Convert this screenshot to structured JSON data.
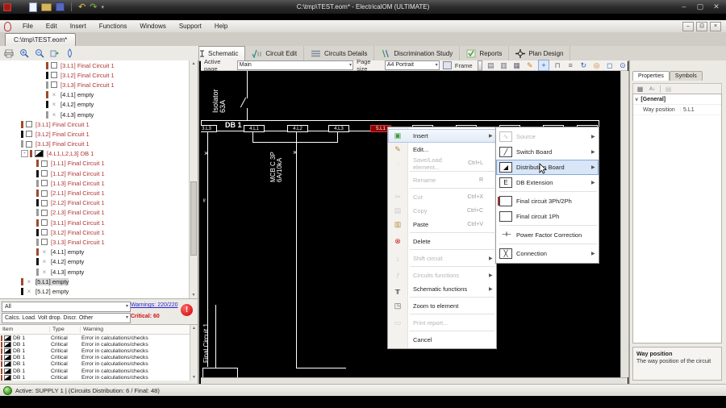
{
  "window": {
    "title": "C:\\tmp\\TEST.eom* - ElectricalOM (ULTIMATE)"
  },
  "menubar": {
    "items": [
      {
        "label": "File"
      },
      {
        "label": "Edit"
      },
      {
        "label": "Insert"
      },
      {
        "label": "Functions"
      },
      {
        "label": "Windows"
      },
      {
        "label": "Support"
      },
      {
        "label": "Help"
      }
    ]
  },
  "doc_tab": {
    "label": "C:\\tmp\\TEST.eom*"
  },
  "ribbon": {
    "tabs": [
      {
        "label": "Schematic"
      },
      {
        "label": "Circuit Edit"
      },
      {
        "label": "Circuits Details"
      },
      {
        "label": "Discrimination Study"
      },
      {
        "label": "Reports"
      },
      {
        "label": "Plan Design"
      }
    ]
  },
  "canvas_toolbar": {
    "active_page_label": "Active page",
    "active_page_value": "Main",
    "page_size_label": "Page size",
    "page_size_value": "A4 Portrait",
    "frame_label": "Frame",
    "icons": [
      "print",
      "export",
      "print-preview",
      "edit",
      "move",
      "ruler",
      "align",
      "refresh",
      "link",
      "select-region",
      "zoom"
    ]
  },
  "left_toolbar": {
    "icons": [
      "print",
      "zoom-in",
      "zoom-out",
      "refresh-tree",
      "validate"
    ]
  },
  "tree": {
    "items": [
      {
        "cls": "ind2 ph-l1 kind-circuit",
        "label": "[3.L1] Final Circuit 1"
      },
      {
        "cls": "ind2 ph-l2 kind-circuit",
        "label": "[3.L2] Final Circuit 1"
      },
      {
        "cls": "ind2 ph-l3 kind-circuit",
        "label": "[3.L3] Final Circuit 1"
      },
      {
        "cls": "ind2 ph-l1 kind-empty",
        "label": "[4.L1] empty"
      },
      {
        "cls": "ind2 ph-l2 kind-empty",
        "label": "[4.L2] empty"
      },
      {
        "cls": "ind2 ph-l3 kind-empty",
        "label": "[4.L3] empty"
      },
      {
        "cls": "ind0 ph-l1 kind-circuit",
        "label": "[3.L1] Final Circuit 1"
      },
      {
        "cls": "ind0 ph-l2 kind-circuit",
        "label": "[3.L2] Final Circuit 1"
      },
      {
        "cls": "ind0 ph-l3 kind-circuit",
        "label": "[3.L3] Final Circuit 1"
      },
      {
        "cls": "ind0 ph-l1 kind-db",
        "label": "[4.L1,L2,L3] DB 1",
        "expander": "-"
      },
      {
        "cls": "ind1 ph-l1 kind-circuit",
        "label": "[1.L1] Final Circuit 1"
      },
      {
        "cls": "ind1 ph-l2 kind-circuit",
        "label": "[1.L2] Final Circuit 1"
      },
      {
        "cls": "ind1 ph-l3 kind-circuit",
        "label": "[1.L3] Final Circuit 1"
      },
      {
        "cls": "ind1 ph-l1 kind-circuit",
        "label": "[2.L1] Final Circuit 1"
      },
      {
        "cls": "ind1 ph-l2 kind-circuit",
        "label": "[2.L2] Final Circuit 1"
      },
      {
        "cls": "ind1 ph-l3 kind-circuit",
        "label": "[2.L3] Final Circuit 1"
      },
      {
        "cls": "ind1 ph-l1 kind-circuit",
        "label": "[3.L1] Final Circuit 1"
      },
      {
        "cls": "ind1 ph-l2 kind-circuit",
        "label": "[3.L2] Final Circuit 1"
      },
      {
        "cls": "ind1 ph-l3 kind-circuit",
        "label": "[3.L3] Final Circuit 1"
      },
      {
        "cls": "ind1 ph-l1 kind-empty",
        "label": "[4.L1] empty"
      },
      {
        "cls": "ind1 ph-l2 kind-empty",
        "label": "[4.L2] empty"
      },
      {
        "cls": "ind1 ph-l3 kind-empty",
        "label": "[4.L3] empty"
      },
      {
        "cls": "ind0 ph-l1 kind-empty selected",
        "label": "[5.L1] empty"
      },
      {
        "cls": "ind0 ph-l2 kind-empty",
        "label": "[5.L2] empty"
      }
    ]
  },
  "filters": {
    "filter_all": "All",
    "filter_types": "Calcs. Load. Volt drop. Discr. Other",
    "warnings_link": "Warnings: 220/220",
    "critical_text": "Critical: 60"
  },
  "warnings_table": {
    "headers": {
      "item": "Item",
      "type": "Type",
      "warning": "Warning"
    },
    "rows": [
      {
        "item": "DB 1",
        "type": "Critical",
        "warning": "Error in calculations/checks"
      },
      {
        "item": "DB 1",
        "type": "Critical",
        "warning": "Error in calculations/checks"
      },
      {
        "item": "DB 1",
        "type": "Critical",
        "warning": "Error in calculations/checks"
      },
      {
        "item": "DB 1",
        "type": "Critical",
        "warning": "Error in calculations/checks"
      },
      {
        "item": "DB 1",
        "type": "Critical",
        "warning": "Error in calculations/checks"
      },
      {
        "item": "DB 1",
        "type": "Critical",
        "warning": "Error in calculations/checks"
      },
      {
        "item": "DB 1",
        "type": "Critical",
        "warning": "Error in calculations/checks"
      }
    ]
  },
  "statusbar": {
    "text": "Active: SUPPLY 1 | (Circuits Distribution: 6 / Final: 48)"
  },
  "canvas": {
    "db_label": "DB 1",
    "isolator_line1": "Isolator",
    "isolator_line2": "63A",
    "mcb_line1": "MCB C 3P",
    "mcb_line2": "6A/10kA",
    "final_circuit": "Final Circuit 1",
    "ways": [
      "3.L3",
      "4.L1",
      "4.L2",
      "4.L3",
      "5.L1",
      "",
      "",
      "",
      "",
      ""
    ]
  },
  "context_menu": {
    "items": [
      {
        "label": "Insert",
        "g": "▣",
        "icon": "ic-insert",
        "arrow": "▶",
        "cls": "hl"
      },
      {
        "label": "Edit...",
        "g": "✎",
        "icon": "ic-edit",
        "cls": ""
      },
      {
        "label": "Save/Load element...",
        "shortcut": "Ctrl+L",
        "g": "◌",
        "icon": "ic-save",
        "cls": "disabled sep-after"
      },
      {
        "label": "Rename",
        "shortcut": "R",
        "cls": "disabled sep-after"
      },
      {
        "label": "Cut",
        "shortcut": "Ctrl+X",
        "g": "✂",
        "icon": "ic-cut",
        "cls": "disabled"
      },
      {
        "label": "Copy",
        "shortcut": "Ctrl+C",
        "g": "▤",
        "icon": "ic-copy",
        "cls": "disabled"
      },
      {
        "label": "Paste",
        "shortcut": "Ctrl+V",
        "g": "▥",
        "icon": "ic-paste",
        "cls": "sep-after"
      },
      {
        "label": "Delete",
        "g": "⊗",
        "icon": "ic-delete",
        "cls": "sep-after"
      },
      {
        "label": "Shift circuit",
        "arrow": "▶",
        "g": "↕",
        "icon": "ic-shift",
        "cls": "disabled sep-after"
      },
      {
        "label": "Circuits functions",
        "arrow": "▶",
        "g": "f",
        "icon": "ic-fn",
        "cls": "disabled"
      },
      {
        "label": "Schematic functions",
        "arrow": "▶",
        "g": "╥",
        "icon": "ic-schem",
        "cls": "sep-after"
      },
      {
        "label": "Zoom to element",
        "g": "◳",
        "icon": "ic-zoomel",
        "cls": "sep-after"
      },
      {
        "label": "Print report...",
        "g": "▭",
        "icon": "ic-print",
        "cls": "disabled sep-after"
      },
      {
        "label": "Cancel",
        "cls": ""
      }
    ]
  },
  "insert_submenu": {
    "items": [
      {
        "label": "Source",
        "arrow": "▶",
        "g": "∿",
        "icon": "",
        "cls": "disabled"
      },
      {
        "label": "Switch Board",
        "arrow": "▶",
        "g": "╱",
        "icon": "",
        "cls": ""
      },
      {
        "label": "Distribution Board",
        "arrow": "▶",
        "g": "◢",
        "icon": "",
        "cls": "hl"
      },
      {
        "label": "DB Extension",
        "arrow": "▶",
        "g": "E",
        "icon": "",
        "cls": "sep-after"
      },
      {
        "label": "Final circuit 3Ph/2Ph",
        "g": "",
        "icon": "sb-3ph",
        "cls": ""
      },
      {
        "label": "Final circuit 1Ph",
        "g": "",
        "icon": "",
        "cls": "sep-after"
      },
      {
        "label": "Power Factor Correction",
        "g": "⊣⊢",
        "icon": "sb-pfc",
        "cls": "sep-after"
      },
      {
        "label": "Connection",
        "arrow": "▶",
        "g": "╳",
        "icon": "",
        "cls": ""
      }
    ]
  },
  "properties_panel": {
    "tab_properties": "Properties",
    "tab_symbols": "Symbols",
    "group": "[General]",
    "rows": [
      {
        "name": "Way position",
        "value": "5.L1"
      }
    ],
    "desc_title": "Way position",
    "desc_text": "The way position of the circuit"
  },
  "colors": {
    "tree_circuit_text": "#b03333",
    "critical": "#cc1111",
    "warnings_link": "#2626cc",
    "selected_way_bg": "#8c0000",
    "canvas_line": "#ffffff"
  }
}
